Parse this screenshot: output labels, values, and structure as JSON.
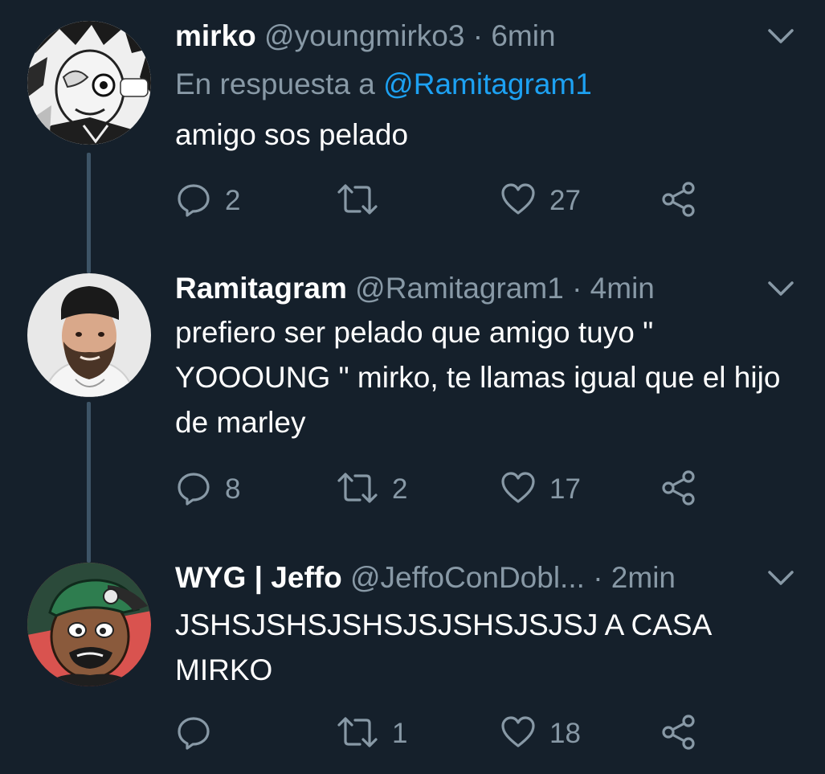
{
  "tweets": [
    {
      "name": "mirko",
      "handle": "@youngmirko3",
      "separator": "·",
      "time": "6min",
      "reply_prefix": "En respuesta a",
      "reply_mention": "@Ramitagram1",
      "text": "amigo sos pelado",
      "reply_count": "2",
      "retweet_count": "",
      "like_count": "27",
      "avatar_icon": "manga-character-avatar"
    },
    {
      "name": "Ramitagram",
      "handle": "@Ramitagram1",
      "separator": "·",
      "time": "4min",
      "text": "prefiero ser pelado que amigo tuyo \" YOOOUNG \" mirko, te llamas igual que el hijo de marley",
      "reply_count": "8",
      "retweet_count": "2",
      "like_count": "17",
      "avatar_icon": "bearded-man-avatar"
    },
    {
      "name": "WYG | Jeffo",
      "handle": "@JeffoConDobl...",
      "separator": "·",
      "time": "2min",
      "text": "JSHSJSHSJSHSJSJSHSJSJSJ A CASA MIRKO",
      "reply_count": "",
      "retweet_count": "1",
      "like_count": "18",
      "avatar_icon": "cartoon-man-cap-avatar"
    }
  ],
  "colors": {
    "background": "#15202b",
    "secondary_text": "#8899a6",
    "link": "#1da1f2",
    "thread_line": "#3d5466"
  }
}
